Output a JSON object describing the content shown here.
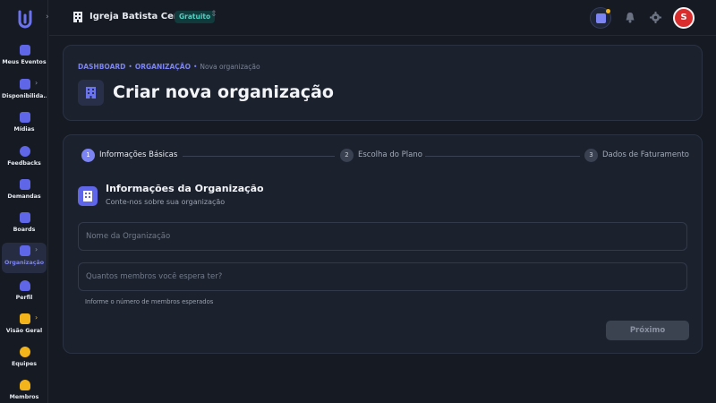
{
  "sidebar": {
    "items": [
      {
        "label": "Meus Eventos",
        "icon": "calendar-icon",
        "color": "blue"
      },
      {
        "label": "Disponibilida...",
        "icon": "calendar-clock-icon",
        "color": "blue"
      },
      {
        "label": "Mídias",
        "icon": "media-icon",
        "color": "blue"
      },
      {
        "label": "Feedbacks",
        "icon": "chat-bubble-icon",
        "color": "blue"
      },
      {
        "label": "Demandas",
        "icon": "inbox-icon",
        "color": "blue"
      },
      {
        "label": "Boards",
        "icon": "board-icon",
        "color": "blue"
      },
      {
        "label": "Organização",
        "icon": "building-icon",
        "color": "blue"
      },
      {
        "label": "Perfil",
        "icon": "user-icon",
        "color": "blue"
      },
      {
        "label": "Visão Geral",
        "icon": "chart-icon",
        "color": "yellow"
      },
      {
        "label": "Equipes",
        "icon": "team-icon",
        "color": "yellow"
      },
      {
        "label": "Membros",
        "icon": "member-icon",
        "color": "yellow"
      }
    ]
  },
  "header": {
    "org_name": "Igreja Batista Central",
    "plan_badge": "Gratuito",
    "avatar_initial": "S"
  },
  "breadcrumb": {
    "dashboard": "DASHBOARD",
    "organizacao": "ORGANIZAÇÃO",
    "current": "Nova organização",
    "separator": "•"
  },
  "page": {
    "title": "Criar nova organização"
  },
  "stepper": {
    "steps": [
      {
        "number": "1",
        "label": "Informações Básicas"
      },
      {
        "number": "2",
        "label": "Escolha do Plano"
      },
      {
        "number": "3",
        "label": "Dados de Faturamento"
      }
    ]
  },
  "form": {
    "section_title": "Informações da Organização",
    "section_subtitle": "Conte-nos sobre sua organização",
    "name_placeholder": "Nome da Organização",
    "members_placeholder": "Quantos membros você espera ter?",
    "members_hint": "Informe o número de membros esperados",
    "next_label": "Próximo"
  },
  "colors": {
    "accent": "#7c83f2",
    "badge_text": "#4fd4c4",
    "avatar_bg": "#d92d2d",
    "warning": "#f2b31b"
  }
}
